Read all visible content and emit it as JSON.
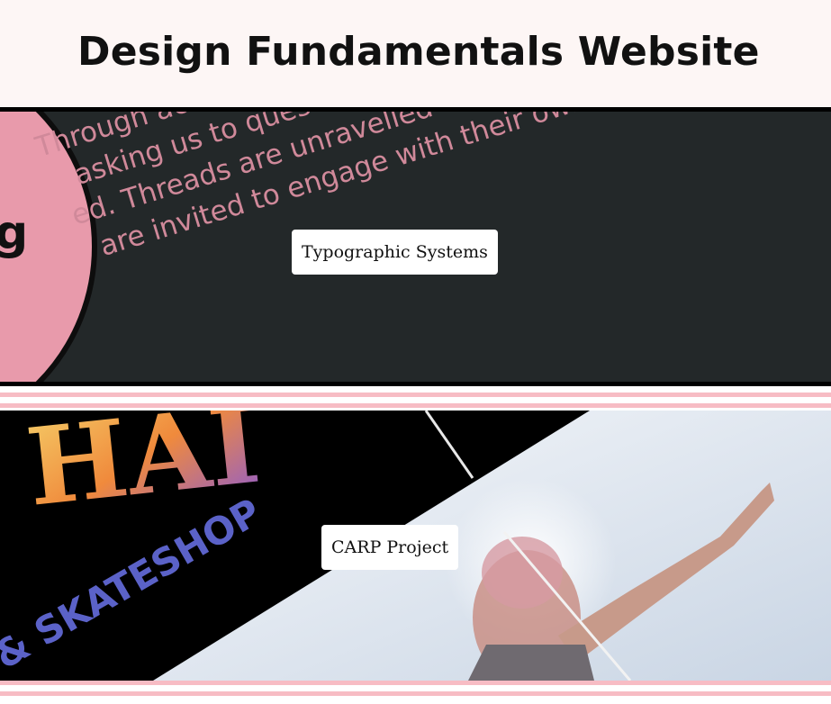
{
  "header": {
    "title": "Design Fundamentals Website"
  },
  "projects": [
    {
      "label": "Typographic Systems",
      "image_text": [
        "Through acts o",
        "asking us to question",
        "ed. Threads are unravelled a",
        "are invited to engage with their own",
        "g"
      ]
    },
    {
      "label": "CARP Project",
      "image_text": [
        "HAI",
        "& SKATESHOP"
      ]
    }
  ],
  "colors": {
    "header_bg": "#fdf6f5",
    "divider": "#f7bcc4",
    "poster_pink": "#e89aab",
    "poster_dark": "#232829"
  }
}
